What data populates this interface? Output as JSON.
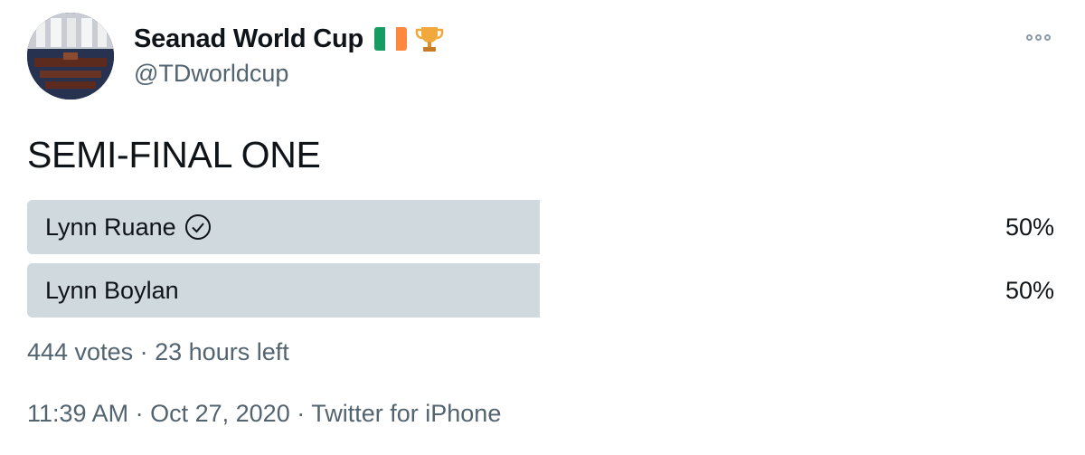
{
  "author": {
    "display_name": "Seanad World Cup",
    "handle": "@TDworldcup",
    "name_emojis": [
      "ireland-flag-icon",
      "trophy-icon"
    ]
  },
  "tweet": {
    "text": "SEMI-FINAL ONE"
  },
  "poll": {
    "options": [
      {
        "label": "Lynn Ruane",
        "percent_text": "50%",
        "percent": 50,
        "selected": true
      },
      {
        "label": "Lynn Boylan",
        "percent_text": "50%",
        "percent": 50,
        "selected": false
      }
    ],
    "votes": "444 votes",
    "separator": "·",
    "time_left": "23 hours left"
  },
  "meta": {
    "time": "11:39 AM",
    "date": "Oct 27, 2020",
    "source": "Twitter for iPhone",
    "separator": "·"
  },
  "colors": {
    "poll_bar": "#cfd9de",
    "secondary_text": "#536471",
    "primary_text": "#0f1419",
    "flag_green": "#169b62",
    "flag_white": "#ffffff",
    "flag_orange": "#ff883e"
  }
}
